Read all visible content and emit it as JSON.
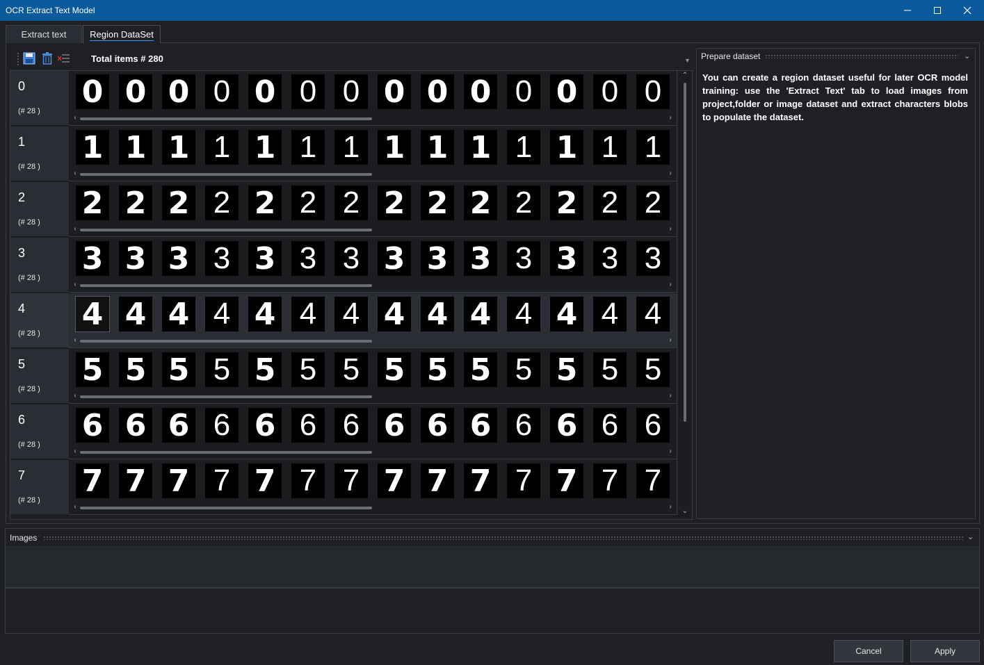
{
  "window": {
    "title": "OCR Extract Text Model"
  },
  "tabs": [
    {
      "label": "Extract text"
    },
    {
      "label": "Region DataSet"
    }
  ],
  "toolbar": {
    "total_items": "Total items # 280"
  },
  "dataset": {
    "rows": [
      {
        "label": "0",
        "count": "(# 28 )",
        "char": "0"
      },
      {
        "label": "1",
        "count": "(# 28 )",
        "char": "1"
      },
      {
        "label": "2",
        "count": "(# 28 )",
        "char": "2"
      },
      {
        "label": "3",
        "count": "(# 28 )",
        "char": "3"
      },
      {
        "label": "4",
        "count": "(# 28 )",
        "char": "4"
      },
      {
        "label": "5",
        "count": "(# 28 )",
        "char": "5"
      },
      {
        "label": "6",
        "count": "(# 28 )",
        "char": "6"
      },
      {
        "label": "7",
        "count": "(# 28 )",
        "char": "7"
      }
    ]
  },
  "prepare_panel": {
    "title": "Prepare dataset",
    "text": "You can create a region dataset useful for later OCR model training: use the 'Extract Text' tab to load images from project,folder or image dataset and extract characters blobs to populate the dataset."
  },
  "images_panel": {
    "title": "Images"
  },
  "footer": {
    "cancel_label": "Cancel",
    "apply_label": "Apply"
  },
  "icons": {
    "minimize": "minimize-icon",
    "maximize": "maximize-icon",
    "close": "close-icon",
    "save": "save-icon",
    "delete": "trash-icon",
    "remove_list": "list-remove-icon"
  },
  "colors": {
    "titlebar": "#0b5a9c",
    "accent": "#3b9cf0",
    "background": "#1e2025"
  }
}
